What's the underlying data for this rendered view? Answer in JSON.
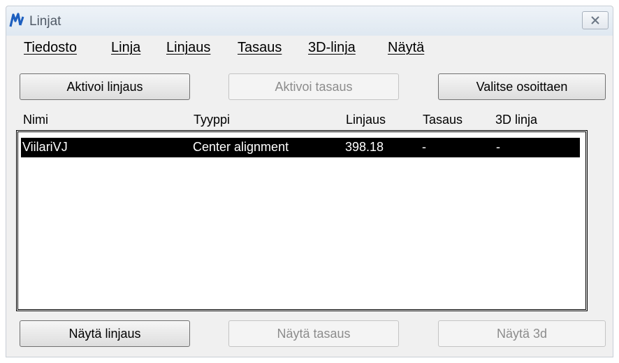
{
  "window": {
    "title": "Linjat",
    "icon": "linjat-app-icon",
    "close_icon": "close-icon"
  },
  "menu": [
    "Tiedosto",
    "Linja",
    "Linjaus",
    "Tasaus",
    "3D-linja",
    "Näytä"
  ],
  "buttons_top": {
    "activate_alignment": "Aktivoi linjaus",
    "activate_profile": "Aktivoi tasaus",
    "select_pointing": "Valitse osoittaen"
  },
  "columns": [
    "Nimi",
    "Tyyppi",
    "Linjaus",
    "Tasaus",
    "3D linja"
  ],
  "rows": [
    {
      "name": "ViilariVJ",
      "type": "Center alignment",
      "alignment": "398.18",
      "profile": "-",
      "line3d": "-",
      "selected": true
    }
  ],
  "buttons_bottom": {
    "show_alignment": "Näytä linjaus",
    "show_profile": "Näytä tasaus",
    "show_3d": "Näytä 3d"
  },
  "colors": {
    "icon_blue": "#1d5fbf",
    "selection": "#000000"
  }
}
